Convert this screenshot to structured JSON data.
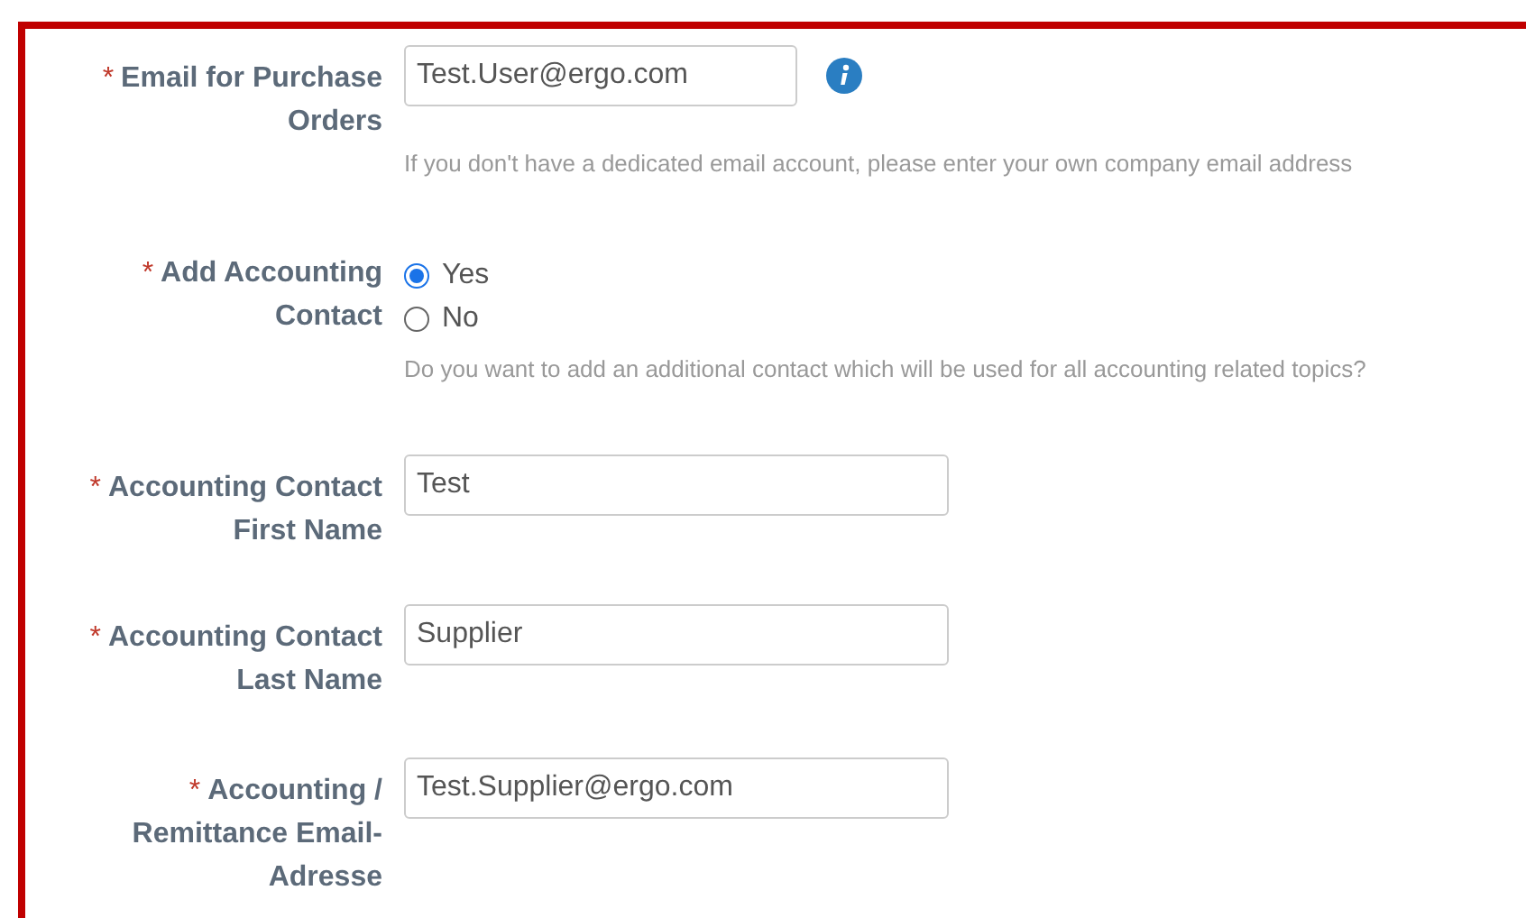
{
  "fields": [
    {
      "kind": "text",
      "marker": "*",
      "label": [
        "Email for Purchase",
        "Orders"
      ],
      "value": "Test.User@ergo.com",
      "info": true,
      "hint": "If you don't have a dedicated email account, please enter your own company email address"
    },
    {
      "kind": "radio",
      "marker": "*",
      "label": [
        "Add Accounting",
        "Contact"
      ],
      "options": [
        {
          "label": "Yes",
          "selected": true
        },
        {
          "label": "No",
          "selected": false
        }
      ],
      "hint": "Do you want to add an additional contact which will be used for all accounting related topics?"
    },
    {
      "kind": "text",
      "marker": "*",
      "label": [
        "Accounting Contact",
        "First Name"
      ],
      "value": "Test",
      "info": false
    },
    {
      "kind": "text",
      "marker": "*",
      "label": [
        "Accounting Contact",
        "Last Name"
      ],
      "value": "Supplier",
      "info": false
    },
    {
      "kind": "text",
      "marker": "*",
      "label": [
        "Accounting /",
        "Remittance Email-",
        "Adresse"
      ],
      "value": "Test.Supplier@ergo.com",
      "info": false
    }
  ]
}
